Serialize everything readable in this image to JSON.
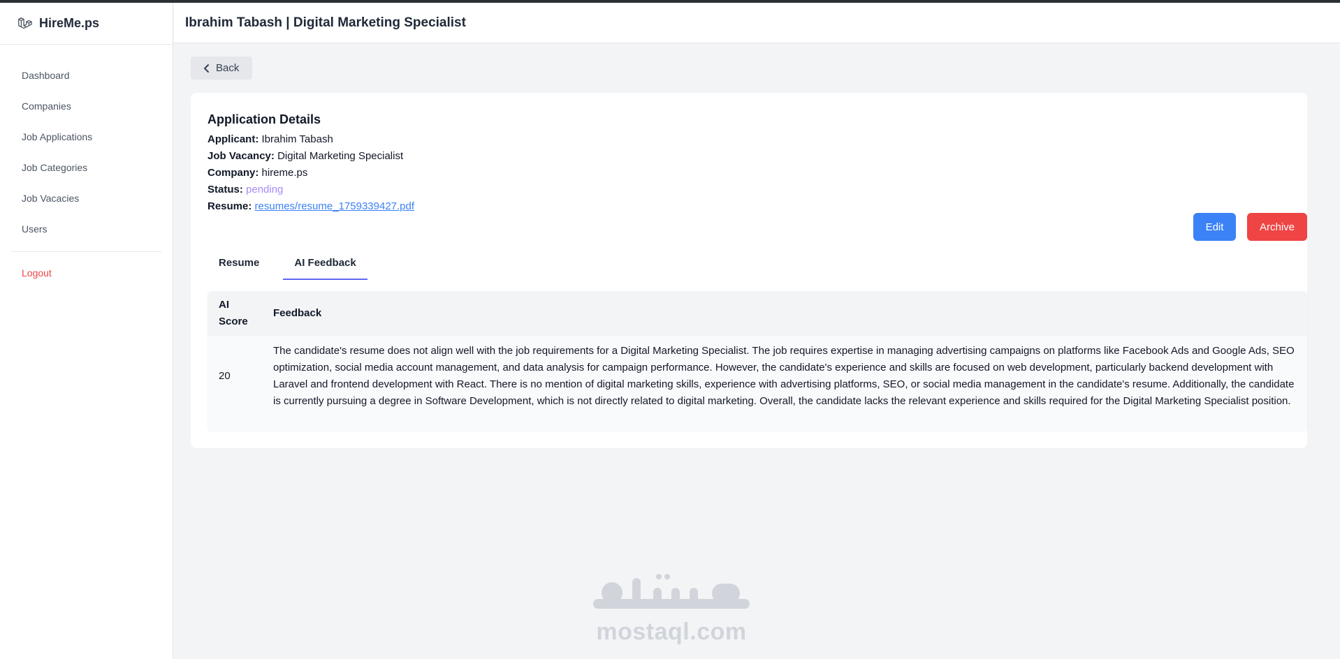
{
  "brand": {
    "name": "HireMe.ps"
  },
  "sidebar": {
    "items": [
      {
        "label": "Dashboard"
      },
      {
        "label": "Companies"
      },
      {
        "label": "Job Applications"
      },
      {
        "label": "Job Categories"
      },
      {
        "label": "Job Vacacies"
      },
      {
        "label": "Users"
      }
    ],
    "logout_label": "Logout"
  },
  "header": {
    "title": "Ibrahim Tabash | Digital Marketing Specialist"
  },
  "back_label": "Back",
  "details": {
    "title": "Application Details",
    "applicant_label": "Applicant:",
    "applicant": "Ibrahim Tabash",
    "vacancy_label": "Job Vacancy:",
    "vacancy": "Digital Marketing Specialist",
    "company_label": "Company:",
    "company": "hireme.ps",
    "status_label": "Status:",
    "status": "pending",
    "resume_label": "Resume:",
    "resume": "resumes/resume_1759339427.pdf"
  },
  "actions": {
    "edit": "Edit",
    "archive": "Archive"
  },
  "tabs": [
    {
      "label": "Resume"
    },
    {
      "label": "AI Feedback"
    }
  ],
  "feedback_table": {
    "headers": {
      "score": "AI Score",
      "feedback": "Feedback"
    },
    "rows": [
      {
        "score": "20",
        "feedback": "The candidate's resume does not align well with the job requirements for a Digital Marketing Specialist. The job requires expertise in managing advertising campaigns on platforms like Facebook Ads and Google Ads, SEO optimization, social media account management, and data analysis for campaign performance. However, the candidate's experience and skills are focused on web development, particularly backend development with Laravel and frontend development with React. There is no mention of digital marketing skills, experience with advertising platforms, SEO, or social media management in the candidate's resume. Additionally, the candidate is currently pursuing a degree in Software Development, which is not directly related to digital marketing. Overall, the candidate lacks the relevant experience and skills required for the Digital Marketing Specialist position."
      }
    ]
  },
  "watermark": {
    "text": "mostaql.com"
  },
  "colors": {
    "primary": "#3b82f6",
    "danger": "#ef4444",
    "status_pending": "#a78bfa",
    "tab_active": "#6366f1"
  }
}
